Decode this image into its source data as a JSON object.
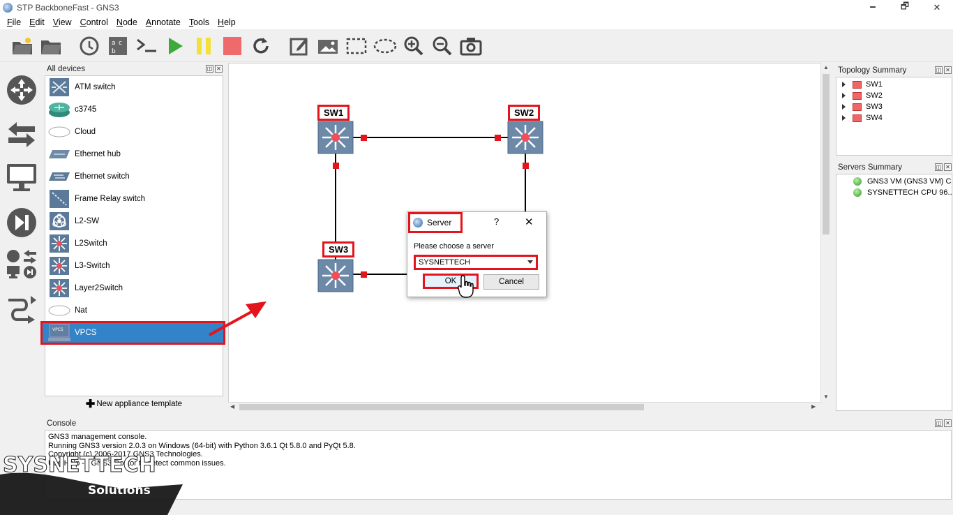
{
  "window": {
    "title": "STP BackboneFast - GNS3",
    "minimize": "🗕",
    "maximize": "🗗",
    "close": "✕"
  },
  "menu": [
    {
      "label": "File",
      "ul": "F",
      "rest": "ile"
    },
    {
      "label": "Edit",
      "ul": "E",
      "rest": "dit"
    },
    {
      "label": "View",
      "ul": "V",
      "rest": "iew"
    },
    {
      "label": "Control",
      "ul": "C",
      "rest": "ontrol"
    },
    {
      "label": "Node",
      "ul": "N",
      "rest": "ode"
    },
    {
      "label": "Annotate",
      "ul": "A",
      "rest": "nnotate"
    },
    {
      "label": "Tools",
      "ul": "T",
      "rest": "ools"
    },
    {
      "label": "Help",
      "ul": "H",
      "rest": "elp"
    }
  ],
  "toolbar": {
    "icons": [
      "new-project-icon",
      "open-project-icon",
      "snapshot-icon",
      "show-interface-labels-icon",
      "console-all-icon",
      "start-all-icon",
      "suspend-all-icon",
      "stop-all-icon",
      "reload-all-icon",
      "add-note-icon",
      "insert-image-icon",
      "draw-rectangle-icon",
      "draw-ellipse-icon",
      "zoom-in-icon",
      "zoom-out-icon",
      "screenshot-icon"
    ]
  },
  "devices_panel": {
    "title": "All devices",
    "items": [
      {
        "label": "ATM switch",
        "icon": "atm-switch-icon"
      },
      {
        "label": "c3745",
        "icon": "router-icon"
      },
      {
        "label": "Cloud",
        "icon": "cloud-icon"
      },
      {
        "label": "Ethernet hub",
        "icon": "ethernet-hub-icon"
      },
      {
        "label": "Ethernet switch",
        "icon": "ethernet-switch-icon"
      },
      {
        "label": "Frame Relay switch",
        "icon": "frame-relay-icon"
      },
      {
        "label": "L2-SW",
        "icon": "biohazard-switch-icon"
      },
      {
        "label": "L2Switch",
        "icon": "multilayer-switch-icon"
      },
      {
        "label": "L3-Switch",
        "icon": "multilayer-switch-icon"
      },
      {
        "label": "Layer2Switch",
        "icon": "multilayer-switch-icon"
      },
      {
        "label": "Nat",
        "icon": "nat-cloud-icon"
      },
      {
        "label": "VPCS",
        "icon": "vpcs-icon",
        "selected": true
      }
    ],
    "new_template": "New appliance template"
  },
  "topology": {
    "nodes": [
      {
        "label": "SW1"
      },
      {
        "label": "SW2"
      },
      {
        "label": "SW3"
      }
    ]
  },
  "dialog": {
    "title": "Server",
    "help": "?",
    "close": "✕",
    "prompt": "Please choose a server",
    "selected_server": "SYSNETTECH",
    "ok": "OK",
    "cancel": "Cancel"
  },
  "topology_summary": {
    "title": "Topology Summary",
    "items": [
      "SW1",
      "SW2",
      "SW3",
      "SW4"
    ]
  },
  "servers_summary": {
    "title": "Servers Summary",
    "items": [
      "GNS3 VM (GNS3 VM) C...",
      "SYSNETTECH CPU 96...."
    ]
  },
  "console": {
    "title": "Console",
    "lines": [
      "GNS3 management console.",
      "Running GNS3 version 2.0.3 on Windows (64-bit) with Python 3.6.1 Qt 5.8.0 and PyQt 5.8.",
      "Copyright (c) 2006-2017 GNS3 Technologies.",
      "Use Help -> GNS3 Doctor to detect common issues."
    ]
  },
  "watermark": {
    "brand": "SYSNETTECH",
    "tagline": "Solutions"
  },
  "colors": {
    "highlight": "#e3141b",
    "selection": "#3383c9",
    "link": "#000000",
    "port": "#e3141b"
  }
}
